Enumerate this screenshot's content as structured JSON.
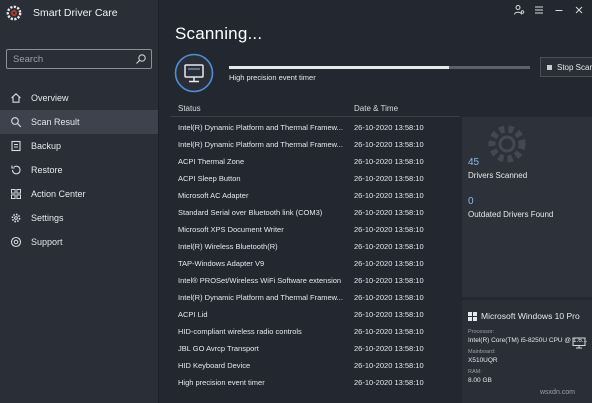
{
  "app": {
    "name": "Smart Driver Care"
  },
  "search": {
    "placeholder": "Search"
  },
  "nav": [
    {
      "label": "Overview",
      "icon": "home-icon",
      "active": false
    },
    {
      "label": "Scan Result",
      "icon": "search-icon",
      "active": true
    },
    {
      "label": "Backup",
      "icon": "backup-icon",
      "active": false
    },
    {
      "label": "Restore",
      "icon": "restore-icon",
      "active": false
    },
    {
      "label": "Action Center",
      "icon": "grid-icon",
      "active": false
    },
    {
      "label": "Settings",
      "icon": "gear-icon",
      "active": false
    },
    {
      "label": "Support",
      "icon": "support-icon",
      "active": false
    }
  ],
  "main": {
    "title": "Scanning...",
    "progress": 0.73,
    "current_item": "High precision event timer",
    "stop_label": "Stop Scan"
  },
  "table": {
    "headers": {
      "status": "Status",
      "date": "Date & Time"
    },
    "rows": [
      {
        "status": "Intel(R) Dynamic Platform and Thermal Framew...",
        "date": "26-10-2020 13:58:10"
      },
      {
        "status": "Intel(R) Dynamic Platform and Thermal Framew...",
        "date": "26-10-2020 13:58:10"
      },
      {
        "status": "ACPI Thermal Zone",
        "date": "26-10-2020 13:58:10"
      },
      {
        "status": "ACPI Sleep Button",
        "date": "26-10-2020 13:58:10"
      },
      {
        "status": "Microsoft AC Adapter",
        "date": "26-10-2020 13:58:10"
      },
      {
        "status": "Standard Serial over Bluetooth link (COM3)",
        "date": "26-10-2020 13:58:10"
      },
      {
        "status": "Microsoft XPS Document Writer",
        "date": "26-10-2020 13:58:10"
      },
      {
        "status": "Intel(R) Wireless Bluetooth(R)",
        "date": "26-10-2020 13:58:10"
      },
      {
        "status": "TAP-Windows Adapter V9",
        "date": "26-10-2020 13:58:10"
      },
      {
        "status": "Intel® PROSet/Wireless WiFi Software extension",
        "date": "26-10-2020 13:58:10"
      },
      {
        "status": "Intel(R) Dynamic Platform and Thermal Framew...",
        "date": "26-10-2020 13:58:10"
      },
      {
        "status": "ACPI Lid",
        "date": "26-10-2020 13:58:10"
      },
      {
        "status": "HID-compliant wireless radio controls",
        "date": "26-10-2020 13:58:10"
      },
      {
        "status": "JBL GO Avrcp Transport",
        "date": "26-10-2020 13:58:10"
      },
      {
        "status": "HID Keyboard Device",
        "date": "26-10-2020 13:58:10"
      },
      {
        "status": "High precision event timer",
        "date": "26-10-2020 13:58:10"
      }
    ]
  },
  "stats": {
    "drivers_scanned": {
      "value": "45",
      "label": "Drivers Scanned"
    },
    "outdated": {
      "value": "0",
      "label": "Outdated Drivers Found"
    }
  },
  "system": {
    "os": "Microsoft Windows 10 Pro",
    "processor_label": "Processor:",
    "processor": "Intel(R) Core(TM) i5-8250U CPU @ 1.6...",
    "mainboard_label": "Mainboard:",
    "mainboard": "X510UQR",
    "ram_label": "RAM:",
    "ram": "8.00 GB"
  },
  "watermark": "wsxdn.com",
  "colors": {
    "accent": "#8fb7e6",
    "background": "#23272f",
    "sidebar": "#2a2e36",
    "active_nav": "#3d424c"
  }
}
